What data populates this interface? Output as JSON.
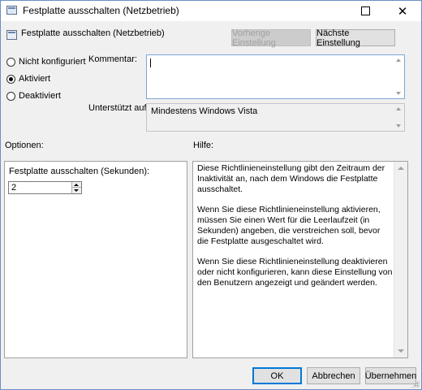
{
  "window": {
    "title": "Festplatte ausschalten (Netzbetrieb)",
    "maximize_icon": "maximize-icon",
    "close_glyph": "✕"
  },
  "policy": {
    "name": "Festplatte ausschalten (Netzbetrieb)",
    "prev_button": "Vorherige Einstellung",
    "next_button": "Nächste Einstellung"
  },
  "state": {
    "options": [
      {
        "label": "Nicht konfiguriert",
        "selected": false
      },
      {
        "label": "Aktiviert",
        "selected": true
      },
      {
        "label": "Deaktiviert",
        "selected": false
      }
    ]
  },
  "comment": {
    "label": "Kommentar:",
    "value": ""
  },
  "supported": {
    "label": "Unterstützt auf:",
    "value": "Mindestens Windows Vista"
  },
  "options_section": {
    "heading": "Optionen:",
    "field_label": "Festplatte ausschalten (Sekunden):",
    "field_value": "2"
  },
  "help_section": {
    "heading": "Hilfe:",
    "paragraphs": [
      "Diese Richtlinieneinstellung gibt den Zeitraum der Inaktivität an, nach dem Windows die Festplatte ausschaltet.",
      "Wenn Sie diese Richtlinieneinstellung aktivieren, müssen Sie einen Wert für die Leerlaufzeit (in Sekunden) angeben, die verstreichen soll, bevor die Festplatte ausgeschaltet wird.",
      "Wenn Sie diese Richtlinieneinstellung deaktivieren oder nicht konfigurieren, kann diese Einstellung von den Benutzern angezeigt und geändert werden."
    ]
  },
  "footer": {
    "ok": "OK",
    "cancel": "Abbrechen",
    "apply": "Übernehmen"
  },
  "colors": {
    "accent": "#0078d7",
    "window_bg": "#f0f0f0"
  }
}
